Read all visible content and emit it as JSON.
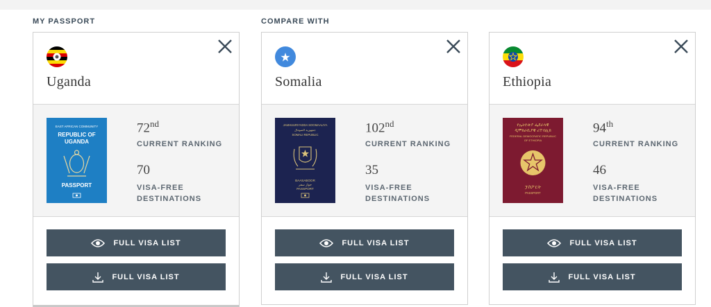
{
  "sections": {
    "my_passport": "MY PASSPORT",
    "compare_with": "COMPARE WITH"
  },
  "cards": [
    {
      "country": "Uganda",
      "ranking_number": "72",
      "ranking_suffix": "nd",
      "ranking_label": "CURRENT RANKING",
      "visa_free_number": "70",
      "visa_free_label_1": "VISA-FREE",
      "visa_free_label_2": "DESTINATIONS",
      "passport_text": [
        "EAST AFRICAN COMMUNITY",
        "REPUBLIC OF",
        "UGANDA",
        "PASSPORT"
      ],
      "passport_color": "#1e7fc4",
      "btn_view": "FULL VISA LIST",
      "btn_download": "FULL VISA LIST"
    },
    {
      "country": "Somalia",
      "ranking_number": "102",
      "ranking_suffix": "nd",
      "ranking_label": "CURRENT RANKING",
      "visa_free_number": "35",
      "visa_free_label_1": "VISA-FREE",
      "visa_free_label_2": "DESTINATIONS",
      "passport_text": [
        "JAMHUURIYADDA SOOMAALIYA",
        "جمهورية الصومال",
        "SOMALI REPUBLIC",
        "BAASABOOR",
        "جواز سفر",
        "PASSPORT"
      ],
      "passport_color": "#1c2350",
      "btn_view": "FULL VISA LIST",
      "btn_download": "FULL VISA LIST"
    },
    {
      "country": "Ethiopia",
      "ranking_number": "94",
      "ranking_suffix": "th",
      "ranking_label": "CURRENT RANKING",
      "visa_free_number": "46",
      "visa_free_label_1": "VISA-FREE",
      "visa_free_label_2": "DESTINATIONS",
      "passport_text": [
        "የኢትዮጵያ ፌደራላዊ",
        "ዲሞክራሲያዊ ሪፐብሊክ",
        "FEDERAL DEMOCRATIC REPUBLIC",
        "OF ETHIOPIA",
        "ፓስፖርት",
        "PASSPORT"
      ],
      "passport_color": "#7d1a30",
      "btn_view": "FULL VISA LIST",
      "btn_download": "FULL VISA LIST"
    }
  ],
  "icons": {
    "close": "close-icon",
    "view": "eye-icon",
    "download": "download-icon"
  },
  "colors": {
    "button_bg": "#445461",
    "label": "#5b6670",
    "card_mid_bg": "#f4f4f4"
  }
}
